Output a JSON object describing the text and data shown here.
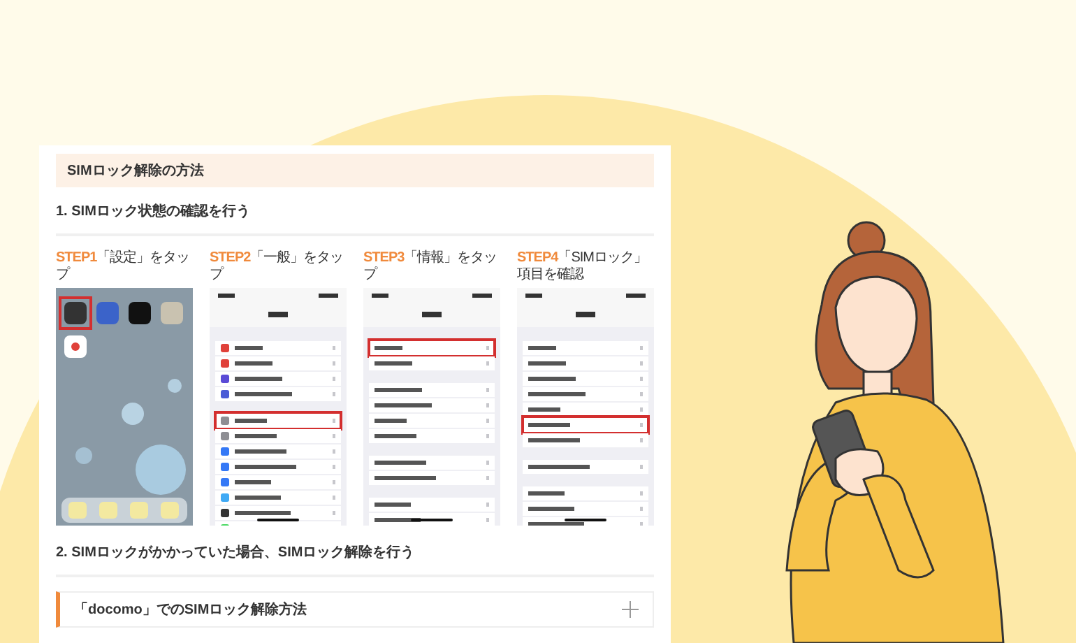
{
  "card": {
    "title": "SIMロック解除の方法"
  },
  "section_1": {
    "heading": "1. SIMロック状態の確認を行う",
    "steps": [
      {
        "step": "STEP1",
        "text": "「設定」をタップ",
        "kind": "home"
      },
      {
        "step": "STEP2",
        "text": "「一般」をタップ",
        "kind": "settings"
      },
      {
        "step": "STEP3",
        "text": "「情報」をタップ",
        "kind": "general"
      },
      {
        "step": "STEP4",
        "text": "「SIMロック」項目を確認",
        "kind": "about"
      }
    ]
  },
  "section_2": {
    "heading": "2. SIMロックがかかっていた場合、SIMロック解除を行う"
  },
  "accordion": {
    "title": "「docomo」でのSIMロック解除方法",
    "expanded": false
  }
}
